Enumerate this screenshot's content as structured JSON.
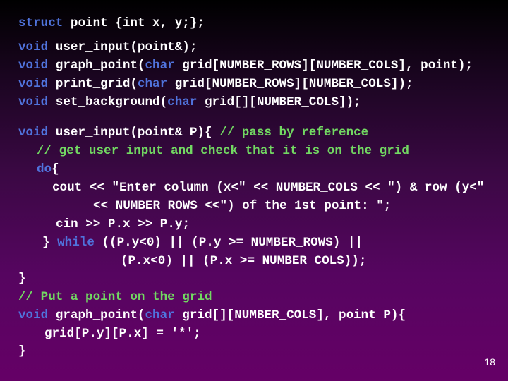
{
  "slide": {
    "page_number": "18",
    "colors": {
      "keyword": "#5073dc",
      "comment": "#72d862",
      "text": "#ffffff",
      "background_top": "#000000",
      "background_bottom": "#650066"
    },
    "code_lines": [
      {
        "id": "struct-decl",
        "tokens": [
          {
            "type": "kw",
            "text": "struct"
          },
          {
            "type": "tx",
            "text": " point {int x, y;};"
          }
        ]
      },
      {
        "id": "proto-user-input",
        "tokens": [
          {
            "type": "kw",
            "text": "void"
          },
          {
            "type": "tx",
            "text": " user_input(point&);"
          }
        ]
      },
      {
        "id": "proto-graph-point",
        "tokens": [
          {
            "type": "kw",
            "text": "void"
          },
          {
            "type": "tx",
            "text": " graph_point("
          },
          {
            "type": "kw",
            "text": "char"
          },
          {
            "type": "tx",
            "text": " grid[NUMBER_ROWS][NUMBER_COLS], point);"
          }
        ]
      },
      {
        "id": "proto-print-grid",
        "tokens": [
          {
            "type": "kw",
            "text": "void"
          },
          {
            "type": "tx",
            "text": " print_grid("
          },
          {
            "type": "kw",
            "text": "char"
          },
          {
            "type": "tx",
            "text": " grid[NUMBER_ROWS][NUMBER_COLS]);"
          }
        ]
      },
      {
        "id": "proto-set-background",
        "tokens": [
          {
            "type": "kw",
            "text": "void"
          },
          {
            "type": "tx",
            "text": " set_background("
          },
          {
            "type": "kw",
            "text": "char"
          },
          {
            "type": "tx",
            "text": " grid[][NUMBER_COLS]);"
          }
        ]
      },
      {
        "id": "def-user-input",
        "tokens": [
          {
            "type": "kw",
            "text": "void"
          },
          {
            "type": "tx",
            "text": " user_input(point& P){ "
          },
          {
            "type": "cm",
            "text": "// pass by reference"
          }
        ]
      },
      {
        "id": "comment-get-input",
        "tokens": [
          {
            "type": "cm",
            "text": "// get user input and check that it is on the grid"
          }
        ]
      },
      {
        "id": "do-open",
        "tokens": [
          {
            "type": "kw",
            "text": "do"
          },
          {
            "type": "tx",
            "text": "{"
          }
        ]
      },
      {
        "id": "cout-line-1",
        "tokens": [
          {
            "type": "tx",
            "text": "cout << \"Enter column (x<\" << NUMBER_COLS << \") & row (y<\""
          }
        ]
      },
      {
        "id": "cout-line-2",
        "tokens": [
          {
            "type": "tx",
            "text": "<< NUMBER_ROWS <<\") of the 1st point: \";"
          }
        ]
      },
      {
        "id": "cin-line",
        "tokens": [
          {
            "type": "tx",
            "text": "cin >> P.x >> P.y;"
          }
        ]
      },
      {
        "id": "while-line-1",
        "tokens": [
          {
            "type": "tx",
            "text": "} "
          },
          {
            "type": "kw",
            "text": "while"
          },
          {
            "type": "tx",
            "text": " ((P.y<0) || (P.y >= NUMBER_ROWS) ||"
          }
        ]
      },
      {
        "id": "while-line-2",
        "tokens": [
          {
            "type": "tx",
            "text": "(P.x<0) || (P.x >= NUMBER_COLS));"
          }
        ]
      },
      {
        "id": "close-user-input",
        "tokens": [
          {
            "type": "tx",
            "text": "}"
          }
        ]
      },
      {
        "id": "comment-put-point",
        "tokens": [
          {
            "type": "cm",
            "text": "// Put a point on the grid"
          }
        ]
      },
      {
        "id": "def-graph-point",
        "tokens": [
          {
            "type": "kw",
            "text": "void"
          },
          {
            "type": "tx",
            "text": " graph_point("
          },
          {
            "type": "kw",
            "text": "char"
          },
          {
            "type": "tx",
            "text": " grid[][NUMBER_COLS], point P){"
          }
        ]
      },
      {
        "id": "assign-star",
        "tokens": [
          {
            "type": "tx",
            "text": "grid[P.y][P.x] = '*';"
          }
        ]
      },
      {
        "id": "close-graph-point",
        "tokens": [
          {
            "type": "tx",
            "text": "}"
          }
        ]
      }
    ]
  }
}
